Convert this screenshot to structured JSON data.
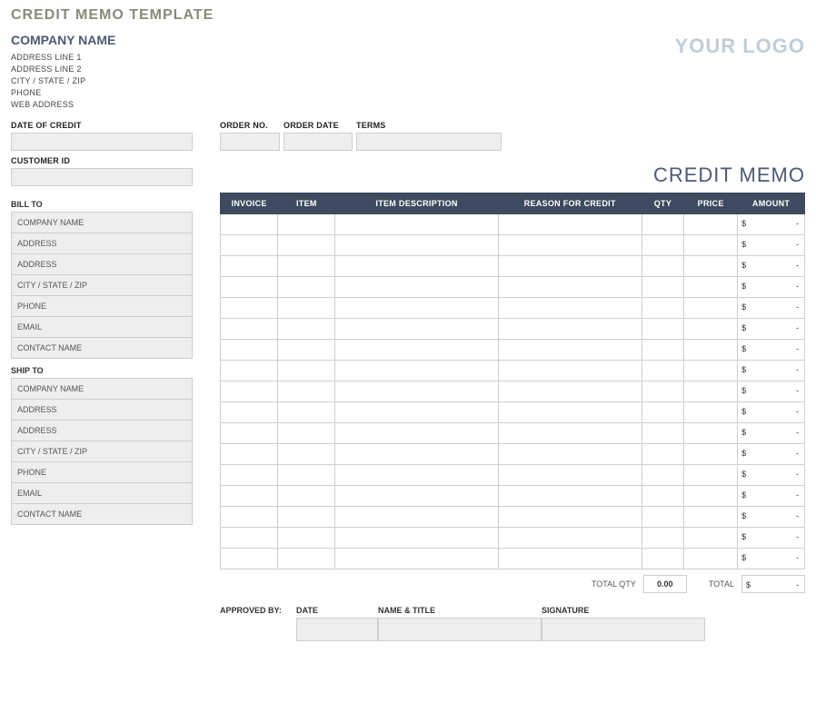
{
  "title": "CREDIT MEMO TEMPLATE",
  "logo_placeholder": "YOUR LOGO",
  "company": {
    "name": "COMPANY NAME",
    "lines": [
      "ADDRESS LINE 1",
      "ADDRESS LINE 2",
      "CITY / STATE / ZIP",
      "PHONE",
      "WEB ADDRESS"
    ]
  },
  "credit_memo_label": "CREDIT MEMO",
  "fields": {
    "date_of_credit_label": "DATE OF CREDIT",
    "customer_id_label": "CUSTOMER ID",
    "order_no_label": "ORDER NO.",
    "order_date_label": "ORDER DATE",
    "terms_label": "TERMS"
  },
  "bill_to": {
    "heading": "BILL TO",
    "rows": [
      "COMPANY NAME",
      "ADDRESS",
      "ADDRESS",
      "CITY / STATE / ZIP",
      "PHONE",
      "EMAIL",
      "CONTACT NAME"
    ]
  },
  "ship_to": {
    "heading": "SHIP TO",
    "rows": [
      "COMPANY NAME",
      "ADDRESS",
      "ADDRESS",
      "CITY / STATE / ZIP",
      "PHONE",
      "EMAIL",
      "CONTACT NAME"
    ]
  },
  "items": {
    "headers": {
      "invoice": "INVOICE",
      "item": "ITEM",
      "description": "ITEM DESCRIPTION",
      "reason": "REASON FOR CREDIT",
      "qty": "QTY",
      "price": "PRICE",
      "amount": "AMOUNT"
    },
    "row_count": 17,
    "amount_symbol": "$",
    "amount_placeholder": "-"
  },
  "totals": {
    "total_qty_label": "TOTAL QTY",
    "total_qty_value": "0.00",
    "total_label": "TOTAL",
    "total_symbol": "$",
    "total_placeholder": "-"
  },
  "approval": {
    "label": "APPROVED BY:",
    "date_label": "DATE",
    "name_title_label": "NAME & TITLE",
    "signature_label": "SIGNATURE"
  }
}
